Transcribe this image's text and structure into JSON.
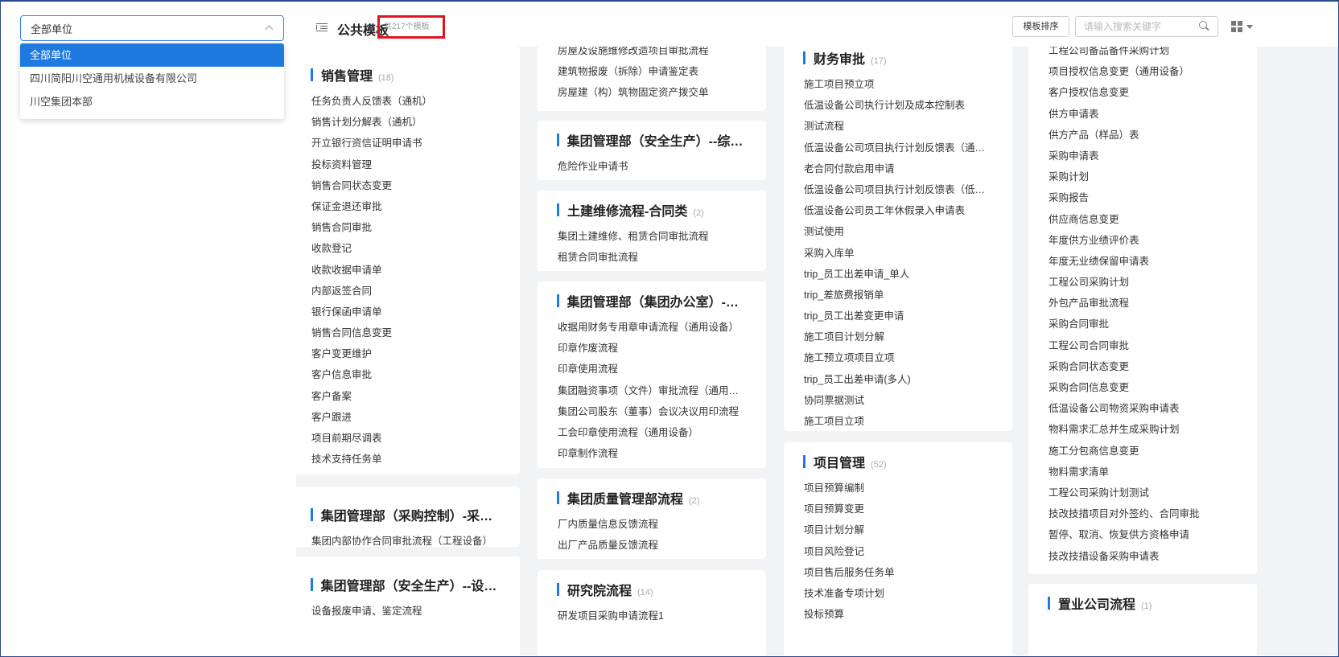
{
  "unit_filter": {
    "selected": "全部单位",
    "options": [
      "全部单位",
      "四川简阳川空通用机械设备有限公司",
      "川空集团本部"
    ]
  },
  "header": {
    "title": "公共模板",
    "count_text": "共217个模板",
    "sort_button": "模板排序",
    "search_placeholder": "请输入搜索关键字"
  },
  "columns": [
    {
      "cards": [
        {
          "title": "销售管理",
          "count": "(18)",
          "items": [
            "任务负责人反馈表（通机）",
            "销售计划分解表（通机）",
            "开立银行资信证明申请书",
            "投标资料管理",
            "销售合同状态变更",
            "保证金退还审批",
            "销售合同审批",
            "收款登记",
            "收款收据申请单",
            "内部返签合同",
            "银行保函申请单",
            "销售合同信息变更",
            "客户变更维护",
            "客户信息审批",
            "客户备案",
            "客户跟进",
            "项目前期尽调表",
            "技术支持任务单"
          ]
        },
        {
          "title": "集团管理部（采购控制）-采购控制",
          "count": "",
          "items": [
            "集团内部协作合同审批流程（工程设备）"
          ]
        },
        {
          "title": "集团管理部（安全生产）--设备管理",
          "count": "",
          "items": [
            "设备报废申请、鉴定流程"
          ]
        }
      ]
    },
    {
      "cards": [
        {
          "title": "",
          "count": "",
          "items": [
            "房屋及设施维修改造项目审批流程",
            "建筑物报废（拆除）申请鉴定表",
            "房屋建（构）筑物固定资产拨交单"
          ]
        },
        {
          "title": "集团管理部（安全生产）--综合安全",
          "count": "",
          "items": [
            "危险作业申请书"
          ]
        },
        {
          "title": "土建维修流程-合同类",
          "count": "(2)",
          "items": [
            "集团土建维修、租赁合同审批流程",
            "租赁合同审批流程"
          ]
        },
        {
          "title": "集团管理部（集团办公室）-印章管理",
          "count": "",
          "items": [
            "收据用财务专用章申请流程（通用设备）",
            "印章作废流程",
            "印章使用流程",
            "集团融资事项（文件）审批流程（通用设备）",
            "集团公司股东（董事）会议决议用印流程",
            "工会印章使用流程（通用设备）",
            "印章制作流程"
          ]
        },
        {
          "title": "集团质量管理部流程",
          "count": "(2)",
          "items": [
            "厂内质量信息反馈流程",
            "出厂产品质量反馈流程"
          ]
        },
        {
          "title": "研究院流程",
          "count": "(14)",
          "items": [
            "研发项目采购申请流程1"
          ]
        }
      ]
    },
    {
      "cards": [
        {
          "title": "财务审批",
          "count": "(17)",
          "items": [
            "施工项目预立项",
            "低温设备公司执行计划及成本控制表",
            "测试流程",
            "低温设备公司项目执行计划反馈表（通用）",
            "老合同付款启用申请",
            "低温设备公司项目执行计划反馈表（低温）",
            "低温设备公司员工年休假录入申请表",
            "测试使用",
            "采购入库单",
            "trip_员工出差申请_单人",
            "trip_差旅费报销单",
            "trip_员工出差变更申请",
            "施工项目计划分解",
            "施工预立项项目立项",
            "trip_员工出差申请(多人)",
            "协同票据测试",
            "施工项目立项"
          ]
        },
        {
          "title": "项目管理",
          "count": "(52)",
          "items": [
            "项目预算编制",
            "项目预算变更",
            "项目计划分解",
            "项目风险登记",
            "项目售后服务任务单",
            "技术准备专项计划",
            "投标预算"
          ]
        }
      ]
    },
    {
      "cards": [
        {
          "title": "",
          "count": "",
          "items": [
            "工程公司备品备件采购计划",
            "项目授权信息变更（通用设备）",
            "客户授权信息变更",
            "供方申请表",
            "供方产品（样品）表",
            "采购申请表",
            "采购计划",
            "采购报告",
            "供应商信息变更",
            "年度供方业绩评价表",
            "年度无业绩保留申请表",
            "工程公司采购计划",
            "外包产品审批流程",
            "采购合同审批",
            "工程公司合同审批",
            "采购合同状态变更",
            "采购合同信息变更",
            "低温设备公司物资采购申请表",
            "物料需求汇总并生成采购计划",
            "施工分包商信息变更",
            "物料需求清单",
            "工程公司采购计划测试",
            "技改技措项目对外签约、合同审批",
            "暂停、取消、恢复供方资格申请",
            "技改技措设备采购申请表"
          ]
        },
        {
          "title": "置业公司流程",
          "count": "(1)",
          "items": []
        }
      ]
    }
  ]
}
